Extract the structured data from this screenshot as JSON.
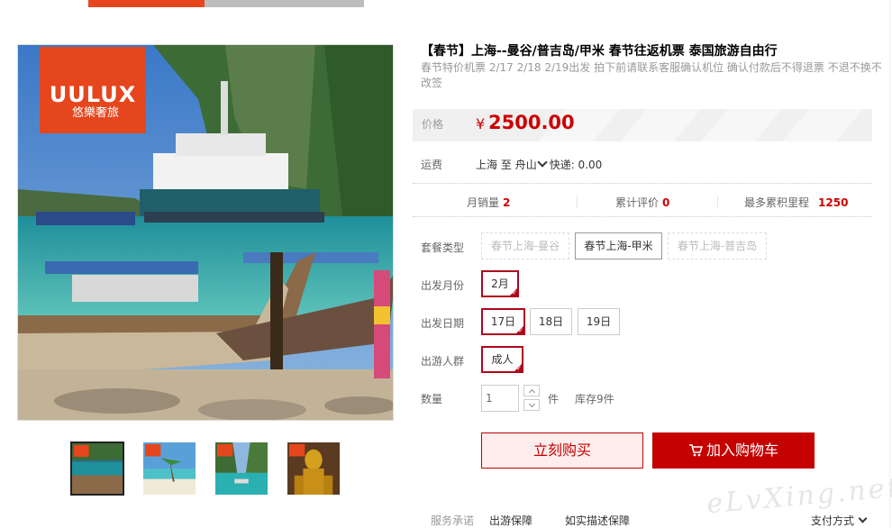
{
  "colors": {
    "brand_orange": "#e5461d",
    "price_red": "#cc0000",
    "button_red": "#c40000",
    "selected_border": "#b0061b"
  },
  "gallery": {
    "logo": {
      "brand": "UULUX",
      "name_cn": "悠樂奢旅"
    },
    "thumbnails": [
      {
        "label": "harbor-boats",
        "active": true
      },
      {
        "label": "beach-palm",
        "active": false
      },
      {
        "label": "cove-boats",
        "active": false
      },
      {
        "label": "golden-statue",
        "active": false
      }
    ]
  },
  "product": {
    "title": "【春节】上海--曼谷/普吉岛/甲米 春节往返机票 泰国旅游自由行",
    "subtitle": "春节特价机票 2/17 2/18 2/19出发 拍下前请联系客服确认机位 确认付款后不得退票 不退不换不改签"
  },
  "price": {
    "label": "价格",
    "currency": "¥",
    "value": "2500.00"
  },
  "shipping": {
    "label": "运费",
    "from": "上海",
    "to_word": "至",
    "dest": "舟山",
    "method": "快递: 0.00"
  },
  "stats": {
    "monthly_sales_label": "月销量",
    "monthly_sales": "2",
    "reviews_label": "累计评价",
    "reviews": "0",
    "mileage_label": "最多累积里程",
    "mileage": "1250"
  },
  "options": {
    "package_label": "套餐类型",
    "packages": [
      "春节上海-曼谷",
      "春节上海-甲米",
      "春节上海-普吉岛"
    ],
    "package_selected": "春节上海-甲米",
    "month_label": "出发月份",
    "months": [
      "2月"
    ],
    "date_label": "出发日期",
    "dates": [
      "17日",
      "18日",
      "19日"
    ],
    "people_label": "出游人群",
    "people": [
      "成人"
    ]
  },
  "quantity": {
    "label": "数量",
    "value": "1",
    "unit": "件",
    "stock": "库存9件"
  },
  "buttons": {
    "buy_now": "立刻购买",
    "add_cart": "加入购物车"
  },
  "service": {
    "label": "服务承诺",
    "items": [
      "出游保障",
      "如实描述保障"
    ],
    "payment": "支付方式"
  },
  "watermark": "eLvXing.net"
}
